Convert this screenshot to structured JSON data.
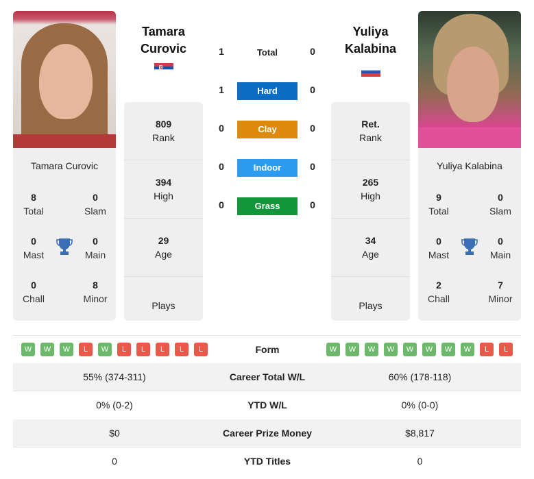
{
  "player1": {
    "first_name": "Tamara",
    "last_name": "Curovic",
    "full_name": "Tamara Curovic",
    "flag": "serbia-flag",
    "titles": {
      "total": "8",
      "total_label": "Total",
      "slam": "0",
      "slam_label": "Slam",
      "mast": "0",
      "mast_label": "Mast",
      "main": "0",
      "main_label": "Main",
      "chall": "0",
      "chall_label": "Chall",
      "minor": "8",
      "minor_label": "Minor"
    },
    "rank": {
      "value": "809",
      "label": "Rank"
    },
    "high": {
      "value": "394",
      "label": "High"
    },
    "age": {
      "value": "29",
      "label": "Age"
    },
    "plays": {
      "value": "",
      "label": "Plays"
    },
    "form": [
      "W",
      "W",
      "W",
      "L",
      "W",
      "L",
      "L",
      "L",
      "L",
      "L"
    ]
  },
  "player2": {
    "first_name": "Yuliya",
    "last_name": "Kalabina",
    "full_name": "Yuliya Kalabina",
    "flag": "russia-flag",
    "titles": {
      "total": "9",
      "total_label": "Total",
      "slam": "0",
      "slam_label": "Slam",
      "mast": "0",
      "mast_label": "Mast",
      "main": "0",
      "main_label": "Main",
      "chall": "2",
      "chall_label": "Chall",
      "minor": "7",
      "minor_label": "Minor"
    },
    "rank": {
      "value": "Ret.",
      "label": "Rank"
    },
    "high": {
      "value": "265",
      "label": "High"
    },
    "age": {
      "value": "34",
      "label": "Age"
    },
    "plays": {
      "value": "",
      "label": "Plays"
    },
    "form": [
      "W",
      "W",
      "W",
      "W",
      "W",
      "W",
      "W",
      "W",
      "L",
      "L"
    ]
  },
  "h2h": [
    {
      "label": "Total",
      "p1": "1",
      "p2": "0",
      "color": null
    },
    {
      "label": "Hard",
      "p1": "1",
      "p2": "0",
      "color": "#0a6cc2"
    },
    {
      "label": "Clay",
      "p1": "0",
      "p2": "0",
      "color": "#dd8a0c"
    },
    {
      "label": "Indoor",
      "p1": "0",
      "p2": "0",
      "color": "#2b9cf2"
    },
    {
      "label": "Grass",
      "p1": "0",
      "p2": "0",
      "color": "#12963a"
    }
  ],
  "comparison": {
    "form_label": "Form",
    "rows": [
      {
        "label": "Career Total W/L",
        "p1": "55% (374-311)",
        "p2": "60% (178-118)"
      },
      {
        "label": "YTD W/L",
        "p1": "0% (0-2)",
        "p2": "0% (0-0)"
      },
      {
        "label": "Career Prize Money",
        "p1": "$0",
        "p2": "$8,817"
      },
      {
        "label": "YTD Titles",
        "p1": "0",
        "p2": "0"
      }
    ]
  }
}
